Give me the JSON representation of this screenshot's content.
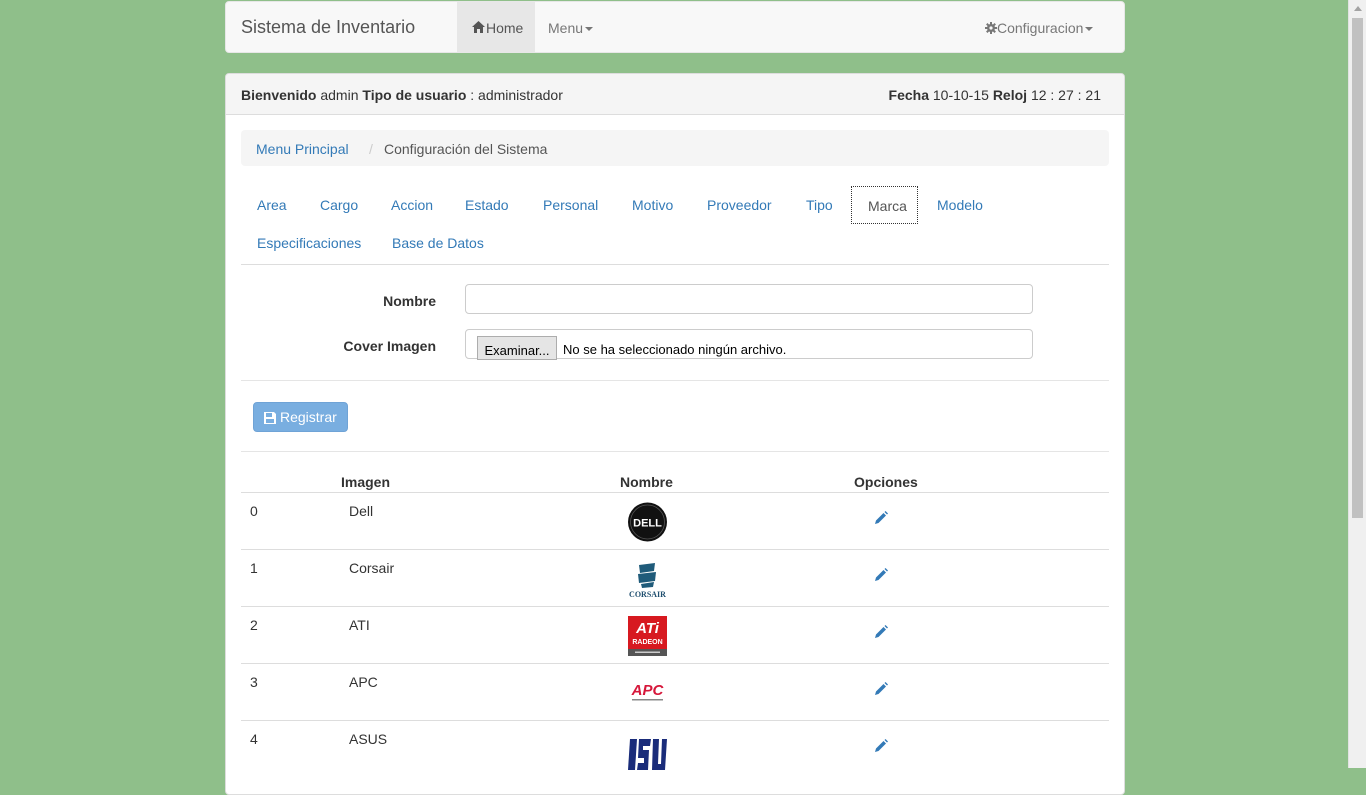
{
  "navbar": {
    "brand": "Sistema de Inventario",
    "home": "Home",
    "menu": "Menu",
    "config": "Configuracion"
  },
  "header": {
    "welcome_label": "Bienvenido",
    "user": "admin",
    "user_type_label": "Tipo de usuario",
    "user_type": ": administrador",
    "date_label": "Fecha",
    "date": "10-10-15",
    "clock_label": "Reloj",
    "clock": "12 : 27 : 21"
  },
  "breadcrumb": {
    "home": "Menu Principal",
    "separator": "/",
    "current": "Configuración del Sistema"
  },
  "tabs": [
    "Area",
    "Cargo",
    "Accion",
    "Estado",
    "Personal",
    "Motivo",
    "Proveedor",
    "Tipo",
    "Marca",
    "Modelo",
    "Especificaciones",
    "Base de Datos"
  ],
  "active_tab": "Marca",
  "form": {
    "nombre_label": "Nombre",
    "nombre_value": "",
    "cover_label": "Cover Imagen",
    "file_button": "Examinar...",
    "file_status": "No se ha seleccionado ningún archivo.",
    "submit": "Registrar"
  },
  "table": {
    "headers": [
      "Imagen",
      "Nombre",
      "Opciones"
    ],
    "rows": [
      {
        "index": "0",
        "name": "Dell",
        "logo": "dell-logo"
      },
      {
        "index": "1",
        "name": "Corsair",
        "logo": "corsair-logo"
      },
      {
        "index": "2",
        "name": "ATI",
        "logo": "ati-logo"
      },
      {
        "index": "3",
        "name": "APC",
        "logo": "apc-logo"
      },
      {
        "index": "4",
        "name": "ASUS",
        "logo": "asus-logo"
      }
    ]
  },
  "colors": {
    "background": "#8fbf8a",
    "link": "#337ab7",
    "button": "#79aee0"
  }
}
